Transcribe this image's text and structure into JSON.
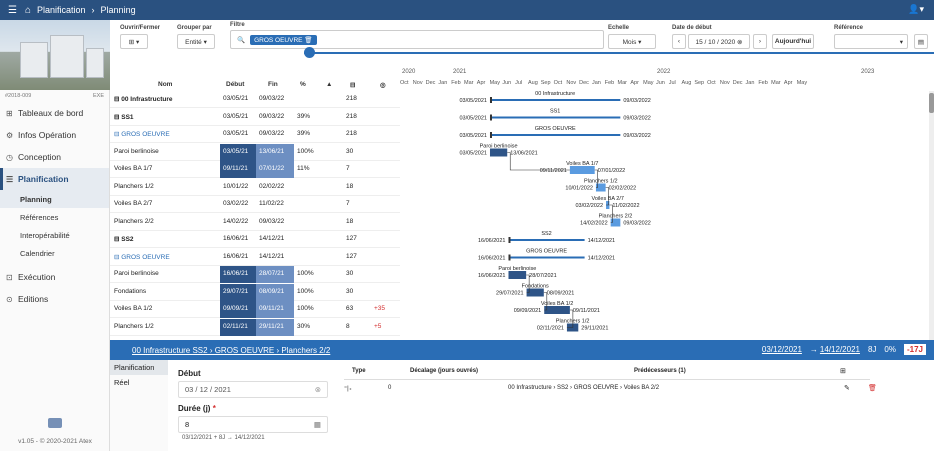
{
  "topbar": {
    "menu_icon": "☰",
    "home_icon": "⌂",
    "bc1": "Planification",
    "sep": "›",
    "bc2": "Planning",
    "user_icon": "👤▾"
  },
  "sidebar": {
    "code_left": "#2018-009",
    "code_right": "EXE",
    "items": [
      {
        "label": "Tableaux de bord",
        "icon": "⊞"
      },
      {
        "label": "Infos Opération",
        "icon": "⚙"
      },
      {
        "label": "Conception",
        "icon": "◷"
      },
      {
        "label": "Planification",
        "icon": "☰"
      },
      {
        "label": "Exécution",
        "icon": "⊡"
      },
      {
        "label": "Editions",
        "icon": "⊙"
      }
    ],
    "subs": [
      "Planning",
      "Références",
      "Interopérabilité",
      "Calendrier"
    ],
    "version": "v1.05 - © 2020-2021 Atex"
  },
  "toolbar": {
    "ouvrir_label": "Ouvrir/Fermer",
    "ouvrir_btn": "⊞ ▾",
    "grouper_label": "Grouper par",
    "grouper_value": "Entité ▾",
    "filtre_label": "Filtre",
    "filtre_icon": "🔍",
    "filtre_chip": "GROS OEUVRE 🗑",
    "echelle_label": "Echelle",
    "echelle_value": "Mois ▾",
    "date_label": "Date de début",
    "date_prev": "‹",
    "date_value": "15 / 10 / 2020 ⊗",
    "date_next": "›",
    "today": "Aujourd'hui",
    "ref_label": "Référence",
    "ref_value": "▾",
    "pdf_icon": "▤"
  },
  "timeline": {
    "years": [
      "2020",
      "2021",
      "2022",
      "2023"
    ],
    "months": [
      "Oct",
      "Nov",
      "Dec",
      "Jan",
      "Feb",
      "Mar",
      "Apr",
      "May",
      "Jun",
      "Jul",
      "Aug",
      "Sep",
      "Oct",
      "Nov",
      "Dec",
      "Jan",
      "Feb",
      "Mar",
      "Apr",
      "May",
      "Jun",
      "Jul",
      "Aug",
      "Sep",
      "Oct",
      "Nov",
      "Dec",
      "Jan",
      "Feb",
      "Mar",
      "Apr",
      "May"
    ]
  },
  "headers": {
    "nom": "Nom",
    "debut": "Début",
    "fin": "Fin",
    "pct": "%",
    "w": "▲",
    "dur": "⊟",
    "mod": "◎"
  },
  "rows": [
    {
      "name": "⊟  00 Infrastructure",
      "deb": "03/05/21",
      "fin": "09/03/22",
      "pct": "",
      "dur": "218",
      "mod": "",
      "hl": ""
    },
    {
      "name": "   ⊟  SS1",
      "deb": "03/05/21",
      "fin": "09/03/22",
      "pct": "39%",
      "dur": "218",
      "mod": "",
      "hl": ""
    },
    {
      "name": "      ⊟  GROS OEUVRE",
      "deb": "03/05/21",
      "fin": "09/03/22",
      "pct": "39%",
      "dur": "218",
      "mod": "",
      "hl": ""
    },
    {
      "name": "            Paroi berlinoise",
      "deb": "03/05/21",
      "fin": "13/06/21",
      "pct": "100%",
      "dur": "30",
      "mod": "",
      "hl": "1"
    },
    {
      "name": "            Voiles BA 1/7",
      "deb": "09/11/21",
      "fin": "07/01/22",
      "pct": "11%",
      "dur": "7",
      "mod": "",
      "hl": "1"
    },
    {
      "name": "            Planchers 1/2",
      "deb": "10/01/22",
      "fin": "02/02/22",
      "pct": "",
      "dur": "18",
      "mod": "",
      "hl": ""
    },
    {
      "name": "            Voiles BA 2/7",
      "deb": "03/02/22",
      "fin": "11/02/22",
      "pct": "",
      "dur": "7",
      "mod": "",
      "hl": ""
    },
    {
      "name": "            Planchers 2/2",
      "deb": "14/02/22",
      "fin": "09/03/22",
      "pct": "",
      "dur": "18",
      "mod": "",
      "hl": ""
    },
    {
      "name": "   ⊟  SS2",
      "deb": "16/06/21",
      "fin": "14/12/21",
      "pct": "",
      "dur": "127",
      "mod": "",
      "hl": ""
    },
    {
      "name": "      ⊟  GROS OEUVRE",
      "deb": "16/06/21",
      "fin": "14/12/21",
      "pct": "",
      "dur": "127",
      "mod": "",
      "hl": ""
    },
    {
      "name": "            Paroi berlinoise",
      "deb": "16/06/21",
      "fin": "28/07/21",
      "pct": "100%",
      "dur": "30",
      "mod": "",
      "hl": "1"
    },
    {
      "name": "            Fondations",
      "deb": "29/07/21",
      "fin": "08/09/21",
      "pct": "100%",
      "dur": "30",
      "mod": "",
      "hl": "1"
    },
    {
      "name": "            Voiles BA 1/2",
      "deb": "09/09/21",
      "fin": "09/11/21",
      "pct": "100%",
      "dur": "63",
      "mod": "+35",
      "hl": "1"
    },
    {
      "name": "            Planchers 1/2",
      "deb": "02/11/21",
      "fin": "29/11/21",
      "pct": "30%",
      "dur": "8",
      "mod": "+5",
      "hl": "2"
    }
  ],
  "gantt": {
    "labels": [
      "00 Infrastructure",
      "SS1",
      "GROS OEUVRE",
      "Paroi berlinoise",
      "Voiles BA 1/7",
      "Planchers 1/2",
      "Voiles BA 2/7",
      "Planchers 2/2",
      "SS2",
      "GROS OEUVRE",
      "Paroi berlinoise",
      "Fondations",
      "Voiles BA 1/2",
      "Planchers 1/2"
    ],
    "dates": [
      "03/05/2021",
      "09/03/2022",
      "03/05/2021",
      "09/03/2022",
      "03/05/2021",
      "09/03/2022",
      "03/05/2021",
      "13/06/2021",
      "09/11/2021",
      "07/01/2022",
      "10/01/2022",
      "02/02/2022",
      "03/02/2022",
      "11/02/2022",
      "14/02/2022",
      "09/03/2022",
      "16/06/2021",
      "14/12/2021",
      "16/06/2021",
      "14/12/2021",
      "16/06/2021",
      "28/07/2021",
      "29/07/2021",
      "08/09/2021",
      "09/09/2021",
      "09/11/2021",
      "02/11/2021",
      "29/11/2021"
    ]
  },
  "detail": {
    "path": "00 Infrastructure SS2 › GROS OEUVRE › Planchers 2/2",
    "start": "03/12/2021",
    "arrow": "→",
    "end": "14/12/2021",
    "dur": "8J",
    "pct": "0%",
    "late": "-17J",
    "tabs": [
      "Planification",
      "Réel"
    ],
    "debut_label": "Début",
    "debut_value": "03 / 12 / 2021",
    "debut_icon": "⊗",
    "duree_label": "Durée (j)",
    "duree_req": "*",
    "duree_value": "8",
    "duree_icon": "▦",
    "hint": "03/12/2021 + 8J → 14/12/2021",
    "col_type": "Type",
    "col_decal": "Décalage (jours ouvrés)",
    "col_pred": "Prédécesseurs (1)",
    "add_icon": "⊞",
    "pred_type": "⁼|₊",
    "pred_decal": "0",
    "pred_path": "00 Infrastructure › SS2 › GROS OEUVRE › Voiles BA 2/2",
    "edit_icon": "✎",
    "delete_icon": "🗑"
  }
}
